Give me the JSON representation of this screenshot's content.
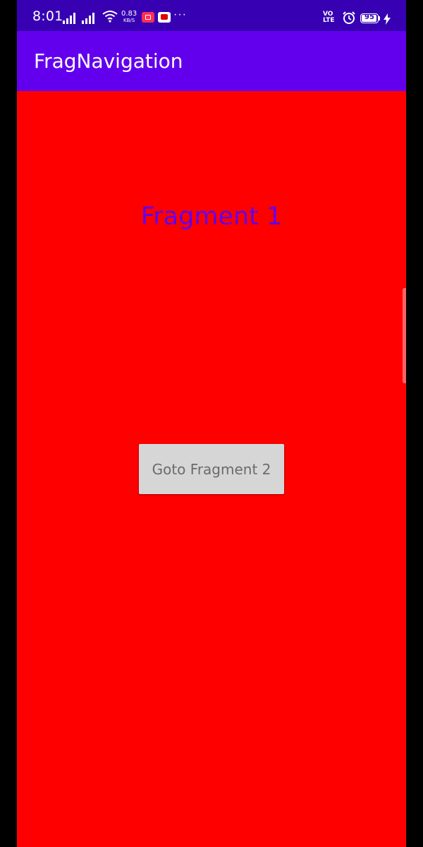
{
  "status_bar": {
    "time": "8:01",
    "network_speed": "0.83",
    "network_speed_unit": "KB/S",
    "more": "···",
    "volte_top": "VO",
    "volte_bottom": "LTE",
    "battery": "95",
    "battery_level": 0.95,
    "icons": [
      "signal-icon",
      "wifi-icon",
      "screen-record-icon",
      "youtube-icon",
      "alarm-icon",
      "charging-icon"
    ],
    "background_color": "#3700b3"
  },
  "app_bar": {
    "title": "FragNavigation",
    "background_color": "#6200ee"
  },
  "content": {
    "background_color": "#ff0000",
    "fragment_title": "Fragment 1",
    "fragment_title_color": "#6200ee",
    "button_label": "Goto Fragment 2"
  }
}
